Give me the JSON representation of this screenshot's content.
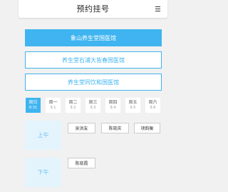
{
  "header": {
    "title": "预约挂号"
  },
  "hospitals": [
    {
      "label": "象山养生堂国医馆",
      "active": true
    },
    {
      "label": "养生堂石浦大皆春国医馆",
      "active": false
    },
    {
      "label": "养生堂同饮和国医馆",
      "active": false
    }
  ],
  "days": [
    {
      "name": "周日",
      "date": "8.31",
      "active": true
    },
    {
      "name": "周一",
      "date": "9.1"
    },
    {
      "name": "周二",
      "date": "9.2"
    },
    {
      "name": "周三",
      "date": "9.3"
    },
    {
      "name": "周四",
      "date": "9.4"
    },
    {
      "name": "周五",
      "date": "9.5"
    },
    {
      "name": "周六",
      "date": "9.6"
    }
  ],
  "schedule": {
    "morning": {
      "label": "上午",
      "doctors": [
        "吴洪友",
        "陈晓庆",
        "项韵衡"
      ]
    },
    "afternoon": {
      "label": "下午",
      "doctors": [
        "陈晓霞"
      ]
    }
  }
}
